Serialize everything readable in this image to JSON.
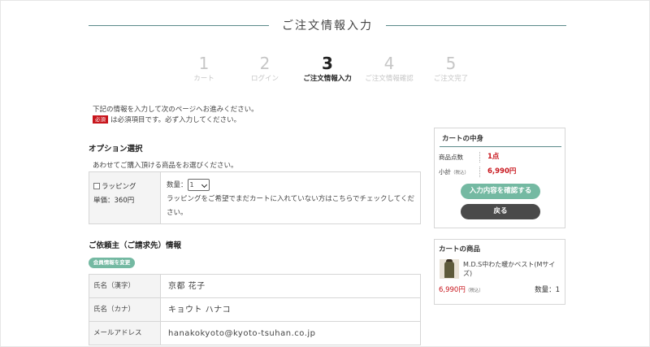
{
  "header": {
    "title": "ご注文情報入力"
  },
  "steps": [
    {
      "num": "1",
      "label": "カート"
    },
    {
      "num": "2",
      "label": "ログイン"
    },
    {
      "num": "3",
      "label": "ご注文情報入力"
    },
    {
      "num": "4",
      "label": "ご注文情報確認"
    },
    {
      "num": "5",
      "label": "ご注文完了"
    }
  ],
  "intro": {
    "line1": "下記の情報を入力して次のページへお進みください。",
    "required_badge": "必須",
    "line2": "は必須項目です。必ず入力してください。"
  },
  "options": {
    "title": "オプション選択",
    "desc": "あわせてご購入頂ける商品をお選びください。",
    "wrapping_label": "ラッピング",
    "unit_price": "単価：360円",
    "qty_label": "数量：",
    "qty_value": "1",
    "note": "ラッピングをご希望でまだカートに入れていない方はこちらでチェックしてください。"
  },
  "customer": {
    "title": "ご依頼主（ご請求先）情報",
    "member_button": "会員情報を変更",
    "rows": [
      {
        "label": "氏名（漢字）",
        "value": "京都 花子"
      },
      {
        "label": "氏名（カナ）",
        "value": "キョウト ハナコ"
      },
      {
        "label": "メールアドレス",
        "value": "hanakokyoto@kyoto-tsuhan.co.jp"
      }
    ]
  },
  "cart": {
    "title": "カートの中身",
    "count_label": "商品点数",
    "count_value": "1点",
    "subtotal_label": "小計",
    "tax_note": "（税込）",
    "subtotal_value": "6,990円",
    "confirm_button": "入力内容を確認する",
    "back_button": "戻る"
  },
  "products": {
    "title": "カートの商品",
    "item_name": "M.D.S中わた暖かベスト(Mサイズ)",
    "item_price": "6,990円",
    "tax_note": "（税込）",
    "item_qty": "数量：1"
  }
}
